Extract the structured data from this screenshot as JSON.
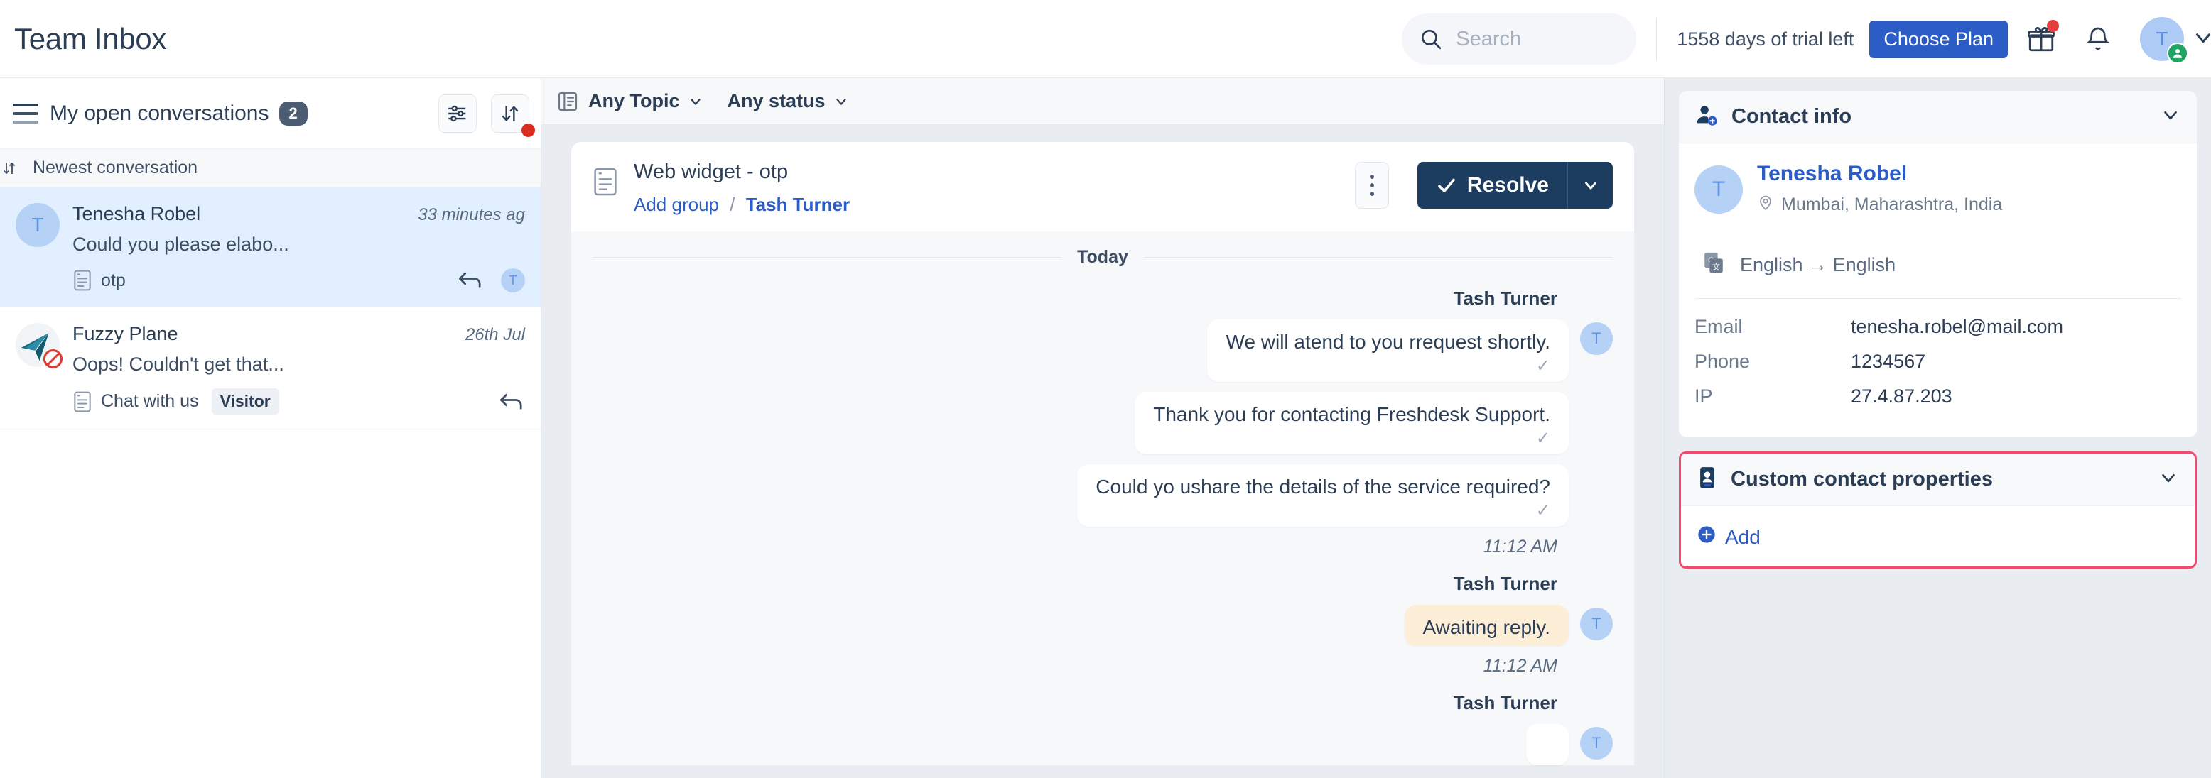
{
  "header": {
    "app_title": "Team Inbox",
    "search_placeholder": "Search",
    "search_value": "",
    "trial_text": "1558 days of trial left",
    "choose_plan_label": "Choose Plan",
    "gift_icon": "gift-icon",
    "bell_icon": "bell-icon",
    "avatar_initial": "T"
  },
  "inbox": {
    "title": "My open conversations",
    "count": "2",
    "sort_label": "Newest conversation",
    "conversations": [
      {
        "name": "Tenesha Robel",
        "time": "33 minutes ag",
        "preview": "Could you please elabo...",
        "channel": "otp",
        "avatar_initial": "T",
        "agent_initial": "T",
        "tag": "",
        "active": true
      },
      {
        "name": "Fuzzy Plane",
        "time": "26th Jul",
        "preview": "Oops! Couldn't get that...",
        "channel": "Chat with us",
        "avatar_initial": "",
        "agent_initial": "",
        "tag": "Visitor",
        "active": false
      }
    ]
  },
  "filters": {
    "topic": "Any Topic",
    "status": "Any status"
  },
  "ticket": {
    "title": "Web widget - otp",
    "add_group_label": "Add group",
    "separator": "/",
    "assignee": "Tash Turner",
    "resolve_label": "Resolve"
  },
  "thread": {
    "day_separator": "Today",
    "groups": [
      {
        "sender": "Tash Turner",
        "avatar_initial": "T",
        "time": "11:12 AM",
        "messages": [
          {
            "text": "We will atend to you rrequest shortly.",
            "kind": "reply",
            "tick": "✓"
          },
          {
            "text": "Thank you for contacting Freshdesk Support.",
            "kind": "reply",
            "tick": "✓"
          },
          {
            "text": "Could yo ushare the details of the service required?",
            "kind": "reply",
            "tick": "✓"
          }
        ]
      },
      {
        "sender": "Tash Turner",
        "avatar_initial": "T",
        "time": "11:12 AM",
        "messages": [
          {
            "text": "Awaiting reply.",
            "kind": "note",
            "tick": ""
          }
        ]
      },
      {
        "sender": "Tash Turner",
        "avatar_initial": "T",
        "time": "",
        "messages": []
      }
    ]
  },
  "contact_panel": {
    "title": "Contact info",
    "avatar_initial": "T",
    "name": "Tenesha Robel",
    "location": "Mumbai, Maharashtra, India",
    "language": "English → English",
    "fields": [
      {
        "label": "Email",
        "value": "tenesha.robel@mail.com"
      },
      {
        "label": "Phone",
        "value": "1234567"
      },
      {
        "label": "IP",
        "value": "27.4.87.203"
      }
    ]
  },
  "custom_properties_panel": {
    "title": "Custom contact properties",
    "add_label": "Add",
    "highlight_color": "#f04a6e"
  },
  "colors": {
    "accent_blue": "#2c5cc5",
    "dark_navy": "#1c3d5f",
    "text": "#2c3e55",
    "active_row": "#e2efff",
    "note_bg": "#fdeed8",
    "presence_green": "#1fa463",
    "alert_red": "#d92d20"
  }
}
